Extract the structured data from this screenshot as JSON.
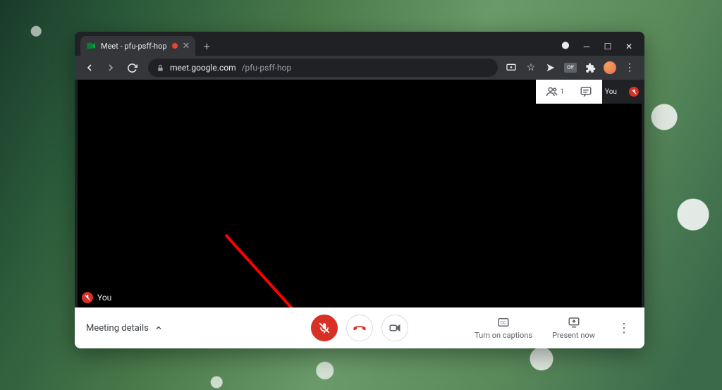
{
  "browser": {
    "tab_title": "Meet - pfu-psff-hop",
    "url_host": "meet.google.com",
    "url_path": "/pfu-psff-hop"
  },
  "top_panel": {
    "participant_count": "1",
    "self_label": "You"
  },
  "video": {
    "self_badge": "You"
  },
  "bottom": {
    "meeting_details": "Meeting details",
    "captions": "Turn on captions",
    "present": "Present now"
  },
  "colors": {
    "accent_red": "#d93025"
  }
}
